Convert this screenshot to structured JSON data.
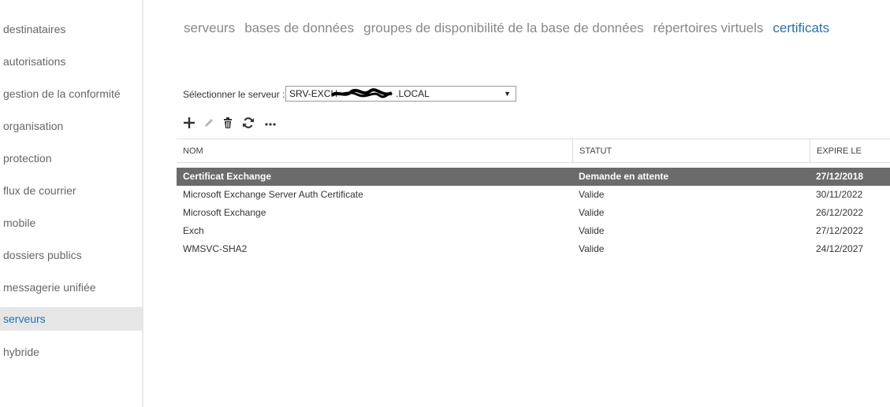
{
  "sidebar": {
    "items": [
      {
        "label": "destinataires",
        "active": false
      },
      {
        "label": "autorisations",
        "active": false
      },
      {
        "label": "gestion de la conformité",
        "active": false
      },
      {
        "label": "organisation",
        "active": false
      },
      {
        "label": "protection",
        "active": false
      },
      {
        "label": "flux de courrier",
        "active": false
      },
      {
        "label": "mobile",
        "active": false
      },
      {
        "label": "dossiers publics",
        "active": false
      },
      {
        "label": "messagerie unifiée",
        "active": false
      },
      {
        "label": "serveurs",
        "active": true
      },
      {
        "label": "hybride",
        "active": false
      }
    ]
  },
  "tabs": [
    {
      "label": "serveurs",
      "active": false
    },
    {
      "label": "bases de données",
      "active": false
    },
    {
      "label": "groupes de disponibilité de la base de données",
      "active": false
    },
    {
      "label": "répertoires virtuels",
      "active": false
    },
    {
      "label": "certificats",
      "active": true
    }
  ],
  "server_select": {
    "label": "Sélectionner le serveur :",
    "value_prefix": "SRV-EXCH",
    "value_suffix": ".LOCAL",
    "caret": "▼"
  },
  "toolbar": {
    "icons": [
      "add-icon",
      "edit-icon",
      "delete-icon",
      "refresh-icon",
      "more-icon"
    ]
  },
  "table": {
    "columns": [
      "NOM",
      "STATUT",
      "EXPIRE LE"
    ],
    "rows": [
      {
        "name": "Certificat Exchange",
        "status": "Demande en attente",
        "expires": "27/12/2018",
        "selected": true
      },
      {
        "name": "Microsoft Exchange Server Auth Certificate",
        "status": "Valide",
        "expires": "30/11/2022",
        "selected": false
      },
      {
        "name": "Microsoft Exchange",
        "status": "Valide",
        "expires": "26/12/2022",
        "selected": false
      },
      {
        "name": "Exch",
        "status": "Valide",
        "expires": "27/12/2022",
        "selected": false
      },
      {
        "name": "WMSVC-SHA2",
        "status": "Valide",
        "expires": "24/12/2027",
        "selected": false
      }
    ]
  },
  "colors": {
    "accent": "#1f74b6",
    "selected_row": "#6b6b6b",
    "sidebar_active": "#e6e6e6"
  }
}
